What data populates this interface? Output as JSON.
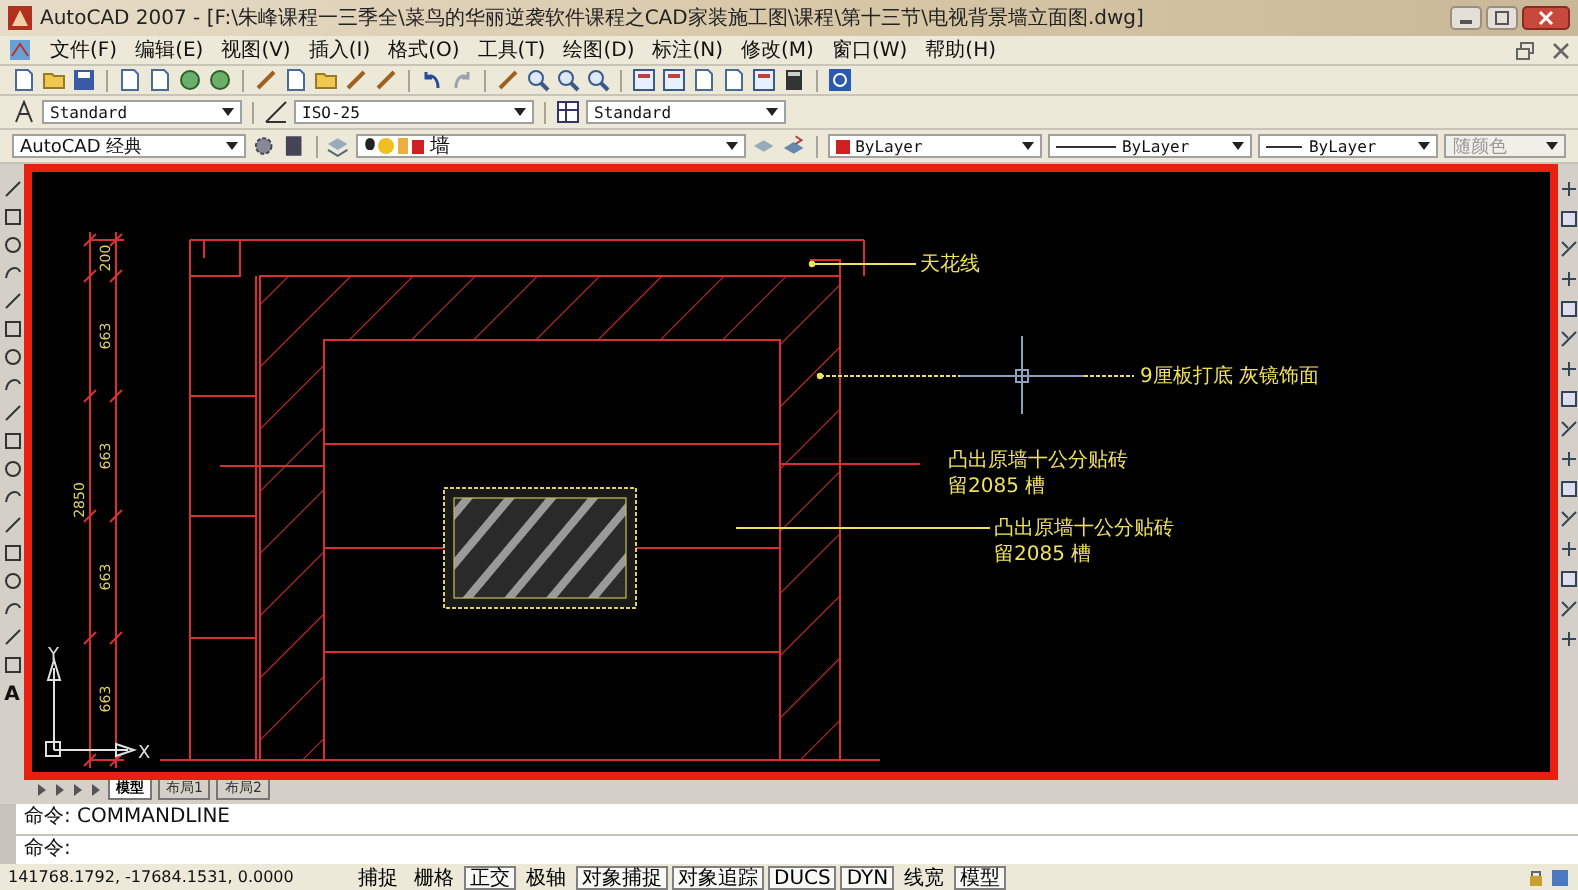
{
  "window": {
    "title": "AutoCAD 2007 - [F:\\朱峰课程一三季全\\菜鸟的华丽逆袭软件课程之CAD家装施工图\\课程\\第十三节\\电视背景墙立面图.dwg]"
  },
  "menu": [
    "文件(F)",
    "编辑(E)",
    "视图(V)",
    "插入(I)",
    "格式(O)",
    "工具(T)",
    "绘图(D)",
    "标注(N)",
    "修改(M)",
    "窗口(W)",
    "帮助(H)"
  ],
  "styles_toolbar": {
    "text_style": "Standard",
    "dim_style": "ISO-25",
    "table_style": "Standard"
  },
  "layers_toolbar": {
    "workspace": "AutoCAD 经典",
    "layer": "墙",
    "color_setting": "ByLayer",
    "linetype": "ByLayer",
    "lineweight": "ByLayer",
    "plot_style": "随颜色"
  },
  "draw_toolbar": {
    "text_tool": "A"
  },
  "drawing": {
    "dimensions": {
      "total": "2850",
      "segments": [
        "200",
        "663",
        "663",
        "663",
        "663"
      ]
    },
    "annotations": [
      {
        "lines": [
          "天花线"
        ]
      },
      {
        "lines": [
          "9厘板打底 灰镜饰面"
        ]
      },
      {
        "lines": [
          "凸出原墙十公分贴砖",
          "留2085 槽"
        ]
      },
      {
        "lines": [
          "凸出原墙十公分贴砖",
          "留2085 槽"
        ]
      }
    ],
    "ucs": {
      "x_label": "X",
      "y_label": "Y"
    }
  },
  "layout_tabs": [
    {
      "label": "模型",
      "selected": true
    },
    {
      "label": "布局1",
      "selected": false
    },
    {
      "label": "布局2",
      "selected": false
    }
  ],
  "command": {
    "history": "命令: COMMANDLINE",
    "prompt": "命令:"
  },
  "status_bar": {
    "coordinates": "141768.1792, -17684.1531, 0.0000",
    "buttons": [
      {
        "label": "捕捉",
        "on": false
      },
      {
        "label": "栅格",
        "on": false
      },
      {
        "label": "正交",
        "on": true
      },
      {
        "label": "极轴",
        "on": false
      },
      {
        "label": "对象捕捉",
        "on": true
      },
      {
        "label": "对象追踪",
        "on": true
      },
      {
        "label": "DUCS",
        "on": true
      },
      {
        "label": "DYN",
        "on": true
      },
      {
        "label": "线宽",
        "on": false
      },
      {
        "label": "模型",
        "on": true
      }
    ]
  }
}
